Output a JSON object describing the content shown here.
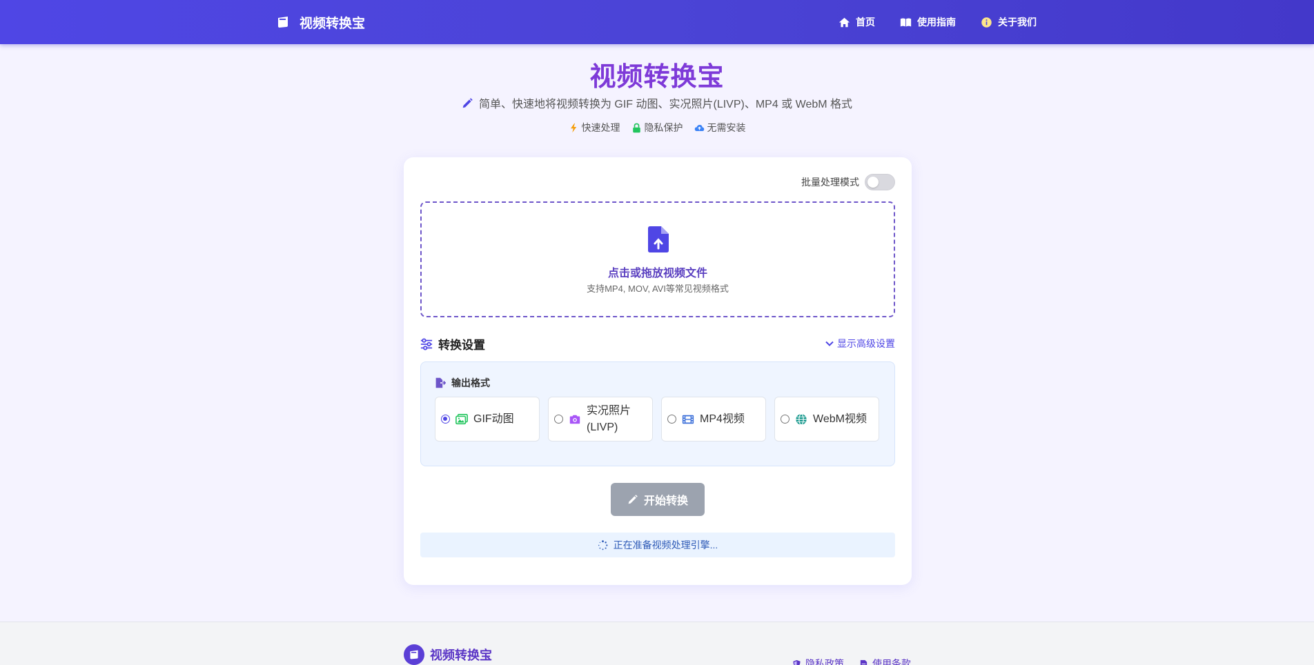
{
  "navbar": {
    "brand": "视频转换宝",
    "links": [
      {
        "label": "首页",
        "icon": "home-icon"
      },
      {
        "label": "使用指南",
        "icon": "book-icon"
      },
      {
        "label": "关于我们",
        "icon": "info-icon"
      }
    ]
  },
  "hero": {
    "title": "视频转换宝",
    "subtitle": "简单、快速地将视频转换为 GIF 动图、实况照片(LIVP)、MP4 或 WebM 格式",
    "features": [
      {
        "label": "快速处理",
        "icon": "bolt-icon"
      },
      {
        "label": "隐私保护",
        "icon": "lock-icon"
      },
      {
        "label": "无需安装",
        "icon": "cloud-icon"
      }
    ]
  },
  "card": {
    "batch_label": "批量处理模式",
    "batch_enabled": false,
    "dropzone": {
      "title": "点击或拖放视频文件",
      "subtitle": "支持MP4, MOV, AVI等常见视频格式"
    },
    "settings": {
      "title": "转换设置",
      "advanced_toggle": "显示高级设置",
      "format_label": "输出格式",
      "options": [
        {
          "label": "GIF动图",
          "icon": "image-icon",
          "checked": true
        },
        {
          "label": "实况照片(LIVP)",
          "icon": "camera-icon",
          "checked": false
        },
        {
          "label": "MP4视频",
          "icon": "film-icon",
          "checked": false
        },
        {
          "label": "WebM视频",
          "icon": "globe-icon",
          "checked": false
        }
      ]
    },
    "start_button": "开始转换",
    "status": "正在准备视频处理引擎..."
  },
  "footer": {
    "brand": "视频转换宝",
    "links": [
      {
        "label": "隐私政策",
        "icon": "shield-icon"
      },
      {
        "label": "使用条款",
        "icon": "file-icon"
      }
    ]
  },
  "colors": {
    "primary": "#4f46e5",
    "title": "#7e3ad8",
    "disabled_button": "#9ca3af",
    "status_bg": "#eaf3ff"
  }
}
